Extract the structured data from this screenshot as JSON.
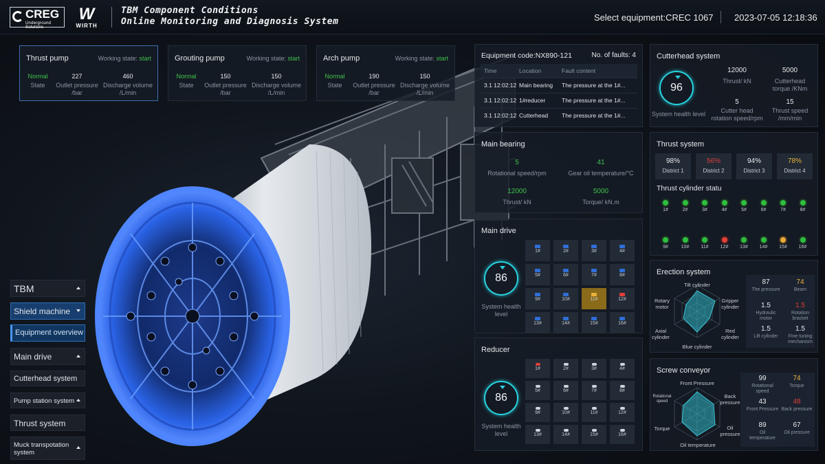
{
  "header": {
    "logo_text": "CREG",
    "logo_sub": "Underground Solutions",
    "logo2_text": "W",
    "logo2_sub": "WIRTH",
    "title_line1": "TBM Component Conditions",
    "title_line2": "Online Monitoring and Diagnosis System",
    "select_equipment": "Select equipment:CREC 1067",
    "datetime": "2023-07-05 12:18:36"
  },
  "pumps": [
    {
      "title": "Thrust pump",
      "ws_label": "Working state:",
      "ws_value": "start",
      "state": "Normal",
      "state_label": "State",
      "outlet": "227",
      "outlet_label": "Outlet pressure /bar",
      "discharge": "460",
      "discharge_label": "Discharge volume /L/min"
    },
    {
      "title": "Grouting pump",
      "ws_label": "Working state:",
      "ws_value": "start",
      "state": "Normal",
      "state_label": "State",
      "outlet": "150",
      "outlet_label": "Outlet pressure /bar",
      "discharge": "150",
      "discharge_label": "Discharge volume /L/min"
    },
    {
      "title": "Arch pump",
      "ws_label": "Working state:",
      "ws_value": "start",
      "state": "Normal",
      "state_label": "State",
      "outlet": "190",
      "outlet_label": "Outlet pressure /bar",
      "discharge": "150",
      "discharge_label": "Discharge volume /L/min"
    }
  ],
  "faults": {
    "equipment_code": "Equipment code:NX890-121",
    "fault_count": "No. of faults: 4",
    "headers": [
      "Time",
      "Location",
      "Fault content"
    ],
    "rows": [
      [
        "3.1 12:02:12",
        "Main bearing",
        "The pressure at the 1#..."
      ],
      [
        "3.1 12:02:12",
        "1#reducer",
        "The pressure at the 1#..."
      ],
      [
        "3.1 12:02:12",
        "Cutterhead",
        "The pressure at the 1#..."
      ]
    ]
  },
  "cutterhead": {
    "title": "Cutterhead system",
    "health": "96",
    "health_label": "System health level",
    "thrust": "12000",
    "thrust_label": "Thrust/ kN",
    "torque": "5000",
    "torque_label": "Cutterhead torque /KNm",
    "speed": "5",
    "speed_label": "Cutter head rotation speed/rpm",
    "thrust_speed": "15",
    "thrust_speed_label": "Thrust speed /mm/min"
  },
  "main_bearing": {
    "title": "Main bearing",
    "rot": "5",
    "rot_label": "Rotational speed/rpm",
    "oil": "41",
    "oil_label": "Gear oil temperature/°C",
    "thrust": "12000",
    "thrust_label": "Thrust/ kN",
    "torque": "5000",
    "torque_label": "Torque/ kN.m"
  },
  "thrust_system": {
    "title": "Thrust system",
    "districts": [
      {
        "pct": "98%",
        "label": "District 1",
        "color": "#e8eaed"
      },
      {
        "pct": "56%",
        "label": "District 2",
        "color": "#e0403a"
      },
      {
        "pct": "94%",
        "label": "District 3",
        "color": "#e8eaed"
      },
      {
        "pct": "78%",
        "label": "District 4",
        "color": "#e9b23a"
      }
    ],
    "cyl_title": "Thrust cylinder statu",
    "cylinders": [
      "1#",
      "2#",
      "3#",
      "4#",
      "5#",
      "6#",
      "7#",
      "8#",
      "9#",
      "10#",
      "11#",
      "12#",
      "13#",
      "14#",
      "15#",
      "16#"
    ]
  },
  "main_drive": {
    "title": "Main drive",
    "health": "86",
    "health_label": "System health level",
    "cells": [
      "1#",
      "2#",
      "3#",
      "4#",
      "5#",
      "6#",
      "7#",
      "8#",
      "9#",
      "10#",
      "11#",
      "12#",
      "13#",
      "14#",
      "15#",
      "16#"
    ]
  },
  "reducer": {
    "title": "Reducer",
    "health": "86",
    "health_label": "System health level",
    "cells": [
      "1#",
      "2#",
      "3#",
      "4#",
      "5#",
      "6#",
      "7#",
      "8#",
      "9#",
      "10#",
      "11#",
      "12#",
      "13#",
      "14#",
      "15#",
      "16#"
    ]
  },
  "erection": {
    "title": "Erection system",
    "radar_labels": {
      "top": "Tilt cylinder",
      "right_top": "Gripper cylinder",
      "right_bottom": "Red cylinder",
      "bottom": "Blue cylinder",
      "left_bottom": "Axial cylinder",
      "left_top": "Rotary motor"
    },
    "stats": [
      {
        "v": "87",
        "t": "The pressure",
        "c": "n"
      },
      {
        "v": "74",
        "t": "Beam",
        "c": "y"
      },
      {
        "v": "1.5",
        "t": "Hydraulic motor",
        "c": "n"
      },
      {
        "v": "1.5",
        "t": "Rotation bracket",
        "c": "r"
      },
      {
        "v": "1.5",
        "t": "Lift cylinder",
        "c": "n"
      },
      {
        "v": "1.5",
        "t": "Fine tuning mechanism",
        "c": "n"
      }
    ]
  },
  "screw": {
    "title": "Screw conveyor",
    "radar_labels": {
      "top": "Front Pressure",
      "right_top": "Back pressure",
      "right_bottom": "Oil pressure",
      "bottom": "Oil temperature",
      "left_bottom": "Torque",
      "left_top": "Rotational speed"
    },
    "stats": [
      {
        "v": "99",
        "t": "Rotational speed",
        "c": "n"
      },
      {
        "v": "74",
        "t": "Torque",
        "c": "y"
      },
      {
        "v": "43",
        "t": "Front Pressure",
        "c": "n"
      },
      {
        "v": "48",
        "t": "Back pressure",
        "c": "r"
      },
      {
        "v": "89",
        "t": "Oil temperature",
        "c": "n"
      },
      {
        "v": "67",
        "t": "Oil pressure",
        "c": "n"
      }
    ]
  },
  "nav": {
    "tbm": "TBM",
    "shield": "Shield machine",
    "overview": "Equipment overview",
    "main_drive": "Main drive",
    "cutterhead": "Cutterhead system",
    "pump_station": "Pump station system",
    "thrust": "Thrust system",
    "muck": "Muck transpotation system"
  }
}
